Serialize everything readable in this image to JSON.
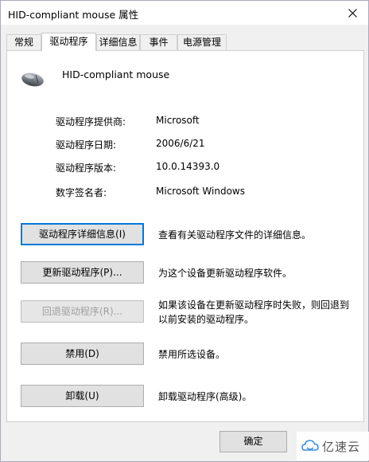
{
  "window": {
    "title": "HID-compliant mouse 属性"
  },
  "tabs": [
    {
      "label": "常规"
    },
    {
      "label": "驱动程序"
    },
    {
      "label": "详细信息"
    },
    {
      "label": "事件"
    },
    {
      "label": "电源管理"
    }
  ],
  "device": {
    "name": "HID-compliant mouse",
    "icon": "mouse-icon"
  },
  "properties": [
    {
      "label": "驱动程序提供商:",
      "value": "Microsoft"
    },
    {
      "label": "驱动程序日期:",
      "value": "2006/6/21"
    },
    {
      "label": "驱动程序版本:",
      "value": "10.0.14393.0"
    },
    {
      "label": "数字签名者:",
      "value": "Microsoft Windows"
    }
  ],
  "actions": [
    {
      "button": "驱动程序详细信息(I)",
      "desc": "查看有关驱动程序文件的详细信息。"
    },
    {
      "button": "更新驱动程序(P)...",
      "desc": "为这个设备更新驱动程序软件。"
    },
    {
      "button": "回退驱动程序(R)...",
      "desc": "如果该设备在更新驱动程序时失败，则回退到以前安装的驱动程序。"
    },
    {
      "button": "禁用(D)",
      "desc": "禁用所选设备。"
    },
    {
      "button": "卸载(U)",
      "desc": "卸载驱动程序(高级)。"
    }
  ],
  "footer": {
    "ok_label": "确定"
  },
  "watermark": {
    "text": "亿速云"
  },
  "colors": {
    "focus": "#0078d7",
    "panel": "#ffffff",
    "window": "#f0f0f0"
  }
}
